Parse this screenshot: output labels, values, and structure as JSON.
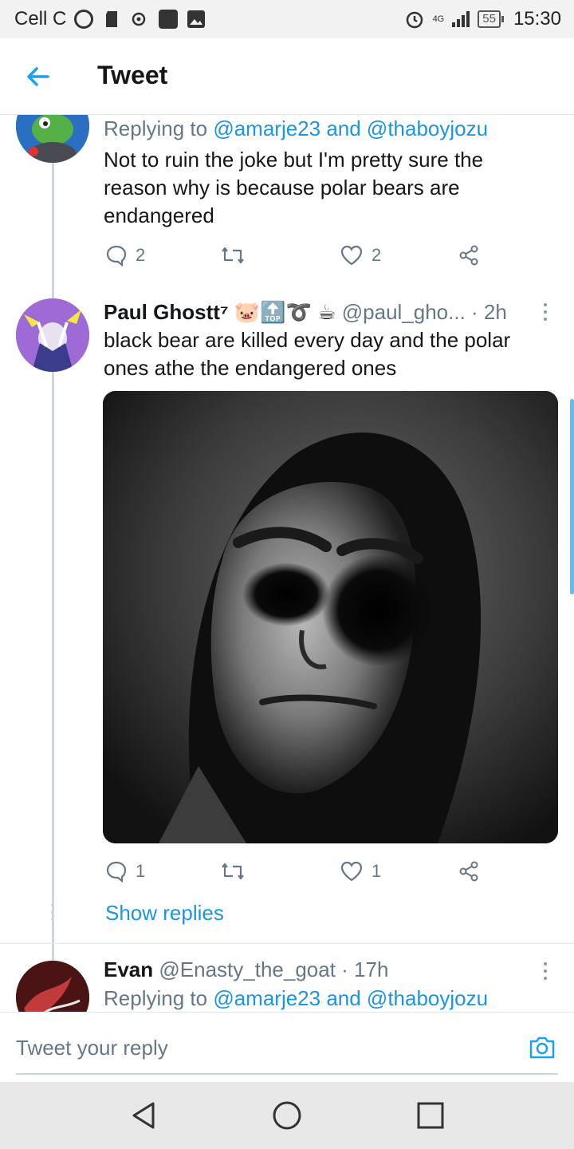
{
  "status_bar": {
    "carrier": "Cell C",
    "network": "4G",
    "battery": "55",
    "time": "15:30"
  },
  "header": {
    "title": "Tweet"
  },
  "tweets": [
    {
      "replying_prefix": "Replying to",
      "replying_users": "@amarje23 and @thaboyjozu",
      "text": "Not to ruin the joke but I'm pretty sure the reason why is because polar bears are endangered",
      "reply_count": "2",
      "retweet_count": "",
      "like_count": "2"
    },
    {
      "name": "Paul Ghostt⁷",
      "emojis": "🐷🔝➰ ☕",
      "handle": "@paul_gho...",
      "time": "· 2h",
      "text": "black bear are killed every day and the polar ones athe the endangered ones",
      "reply_count": "1",
      "retweet_count": "",
      "like_count": "1",
      "show_replies": "Show replies"
    },
    {
      "name": "Evan",
      "handle": "@Enasty_the_goat",
      "time": "· 17h",
      "replying_prefix": "Replying to",
      "replying_users": "@amarje23 and @thaboyjozu"
    }
  ],
  "reply_bar": {
    "placeholder": "Tweet your reply"
  },
  "colors": {
    "accent": "#1b95e0",
    "muted": "#657786",
    "text": "#14171a"
  }
}
